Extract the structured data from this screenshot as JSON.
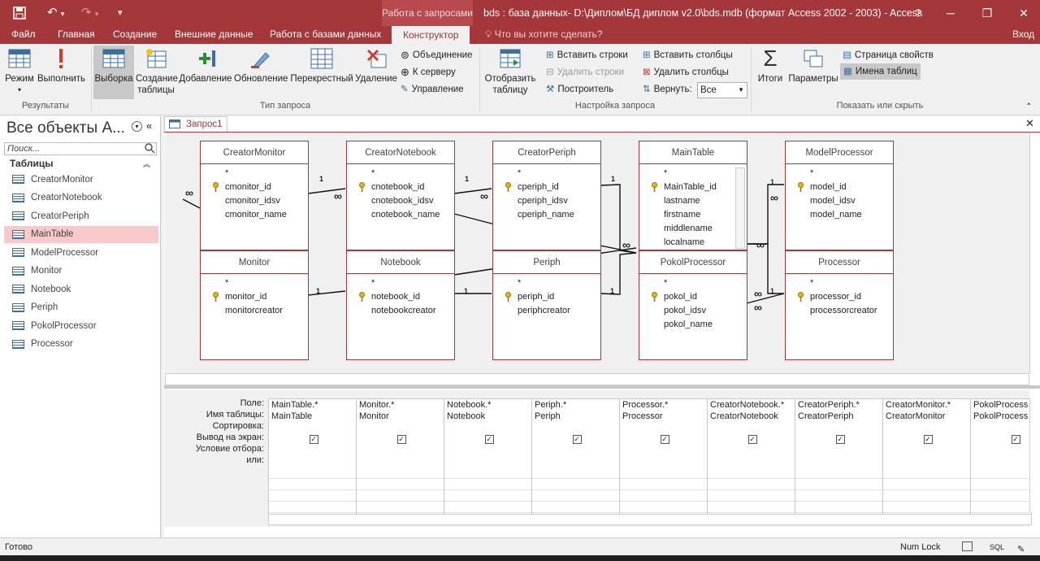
{
  "window": {
    "context_tab": "Работа с запросами",
    "title": "bds : база данных- D:\\Диплом\\БД диплом v2.0\\bds.mdb (формат Access 2002 - 2003) - Access",
    "help": "?",
    "signin": "Вход"
  },
  "tabs": [
    "Файл",
    "Главная",
    "Создание",
    "Внешние данные",
    "Работа с базами данных",
    "Конструктор"
  ],
  "tellme": "Что вы хотите сделать?",
  "ribbon": {
    "results": {
      "label": "Результаты",
      "mode": "Режим",
      "run": "Выполнить"
    },
    "query_type": {
      "label": "Тип запроса",
      "select": "Выборка",
      "make_table": "Создание таблицы",
      "append": "Добавление",
      "update": "Обновление",
      "crosstab": "Перекрестный",
      "delete": "Удаление",
      "union": "Объединение",
      "pass_through": "К серверу",
      "data_def": "Управление"
    },
    "setup": {
      "label": "Настройка запроса",
      "show_table": "Отобразить таблицу",
      "insert_rows": "Вставить строки",
      "delete_rows": "Удалить строки",
      "builder": "Построитель",
      "insert_cols": "Вставить столбцы",
      "delete_cols": "Удалить столбцы",
      "return_label": "Вернуть:",
      "return_value": "Все"
    },
    "show_hide": {
      "label": "Показать или скрыть",
      "totals": "Итоги",
      "params": "Параметры",
      "props": "Страница свойств",
      "table_names": "Имена таблиц"
    }
  },
  "nav": {
    "title": "Все объекты А...",
    "search_placeholder": "Поиск...",
    "section": "Таблицы",
    "items": [
      "CreatorMonitor",
      "CreatorNotebook",
      "CreatorPeriph",
      "MainTable",
      "ModelProcessor",
      "Monitor",
      "Notebook",
      "Periph",
      "PokolProcessor",
      "Processor"
    ]
  },
  "doc_tab": "Запрос1",
  "tables": [
    {
      "name": "CreatorMonitor",
      "fields": [
        "*",
        "cmonitor_id",
        "cmonitor_idsv",
        "cmonitor_name"
      ],
      "key": 1
    },
    {
      "name": "CreatorNotebook",
      "fields": [
        "*",
        "cnotebook_id",
        "cnotebook_idsv",
        "cnotebook_name"
      ],
      "key": 1
    },
    {
      "name": "CreatorPeriph",
      "fields": [
        "*",
        "cperiph_id",
        "cperiph_idsv",
        "cperiph_name"
      ],
      "key": 1
    },
    {
      "name": "MainTable",
      "fields": [
        "*",
        "MainTable_id",
        "lastname",
        "firstname",
        "middlename",
        "localname"
      ],
      "key": 1
    },
    {
      "name": "ModelProcessor",
      "fields": [
        "*",
        "model_id",
        "model_idsv",
        "model_name"
      ],
      "key": 1
    },
    {
      "name": "Monitor",
      "fields": [
        "*",
        "monitor_id",
        "monitorcreator"
      ],
      "key": 1
    },
    {
      "name": "Notebook",
      "fields": [
        "*",
        "notebook_id",
        "notebookcreator"
      ],
      "key": 1
    },
    {
      "name": "Periph",
      "fields": [
        "*",
        "periph_id",
        "periphcreator"
      ],
      "key": 1
    },
    {
      "name": "PokolProcessor",
      "fields": [
        "*",
        "pokol_id",
        "pokol_idsv",
        "pokol_name"
      ],
      "key": 1
    },
    {
      "name": "Processor",
      "fields": [
        "*",
        "processor_id",
        "processorcreator"
      ],
      "key": 1
    }
  ],
  "relation_marks": {
    "one": "1",
    "many": "∞"
  },
  "grid": {
    "row_labels": [
      "Поле:",
      "Имя таблицы:",
      "Сортировка:",
      "Вывод на экран:",
      "Условие отбора:",
      "или:"
    ],
    "columns": [
      {
        "field": "MainTable.*",
        "table": "MainTable",
        "show": true
      },
      {
        "field": "Monitor.*",
        "table": "Monitor",
        "show": true
      },
      {
        "field": "Notebook.*",
        "table": "Notebook",
        "show": true
      },
      {
        "field": "Periph.*",
        "table": "Periph",
        "show": true
      },
      {
        "field": "Processor.*",
        "table": "Processor",
        "show": true
      },
      {
        "field": "CreatorNotebook.*",
        "table": "CreatorNotebook",
        "show": true
      },
      {
        "field": "CreatorPeriph.*",
        "table": "CreatorPeriph",
        "show": true
      },
      {
        "field": "CreatorMonitor.*",
        "table": "CreatorMonitor",
        "show": true
      },
      {
        "field": "PokolProcess",
        "table": "PokolProcess",
        "show": true
      }
    ]
  },
  "status": {
    "left": "Готово",
    "numlock": "Num Lock",
    "sql": "SQL"
  },
  "colors": {
    "accent": "#a4373a",
    "selected_nav": "#f8c9ca"
  }
}
